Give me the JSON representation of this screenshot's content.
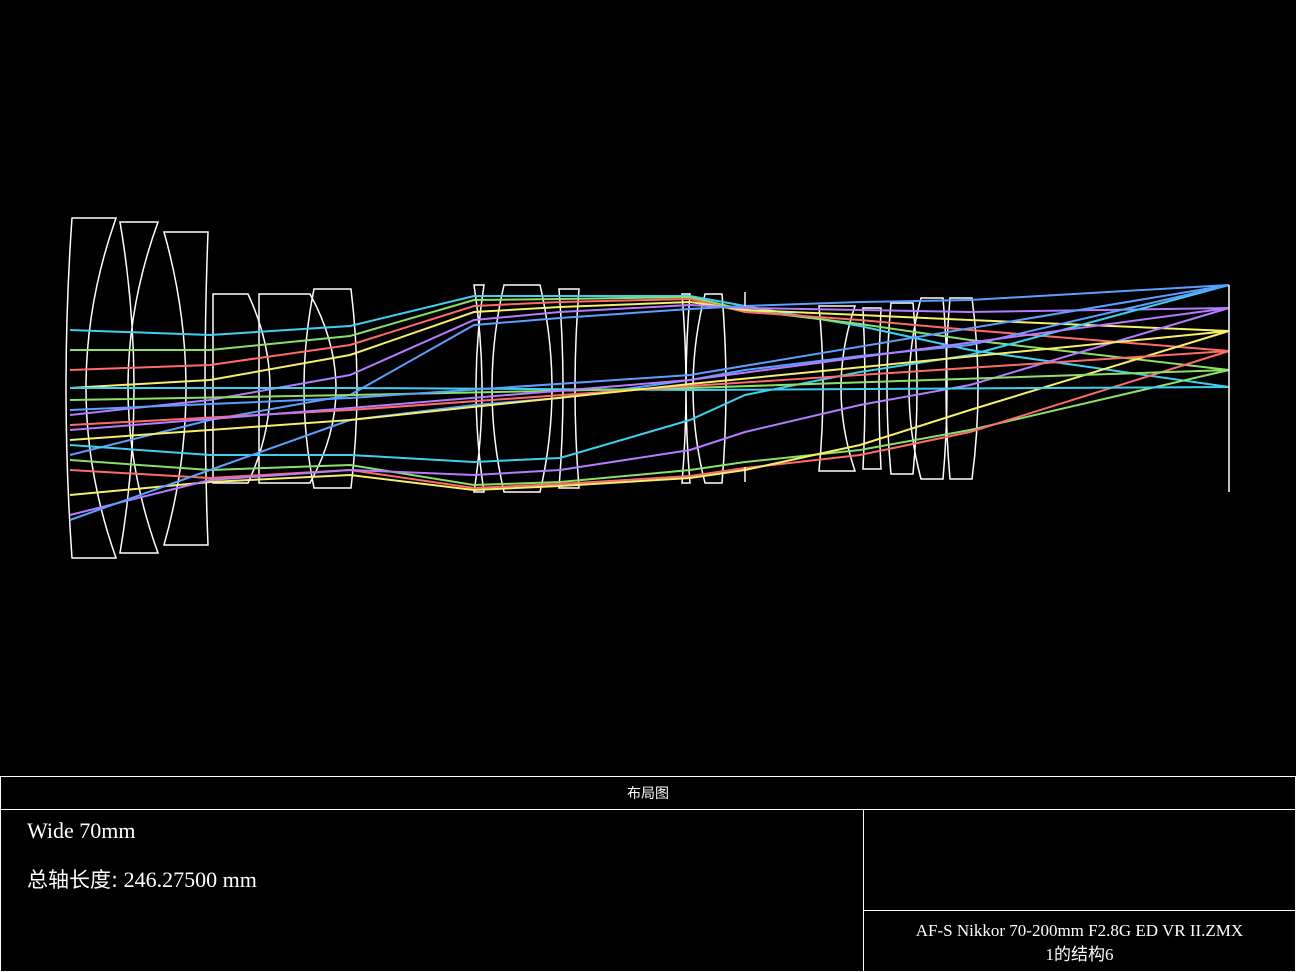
{
  "panel_title": "布局图",
  "zoom_label": "Wide 70mm",
  "total_length_label": "总轴长度:",
  "total_length_value": "246.27500 mm",
  "file_name": "AF-S Nikkor 70-200mm F2.8G ED VR II.ZMX",
  "configuration": "1的结构6",
  "ray_colors": [
    "#3fd0f0",
    "#8ce06a",
    "#ff6b6b",
    "#f5ef6b",
    "#b47cff",
    "#5ba0ff"
  ]
}
